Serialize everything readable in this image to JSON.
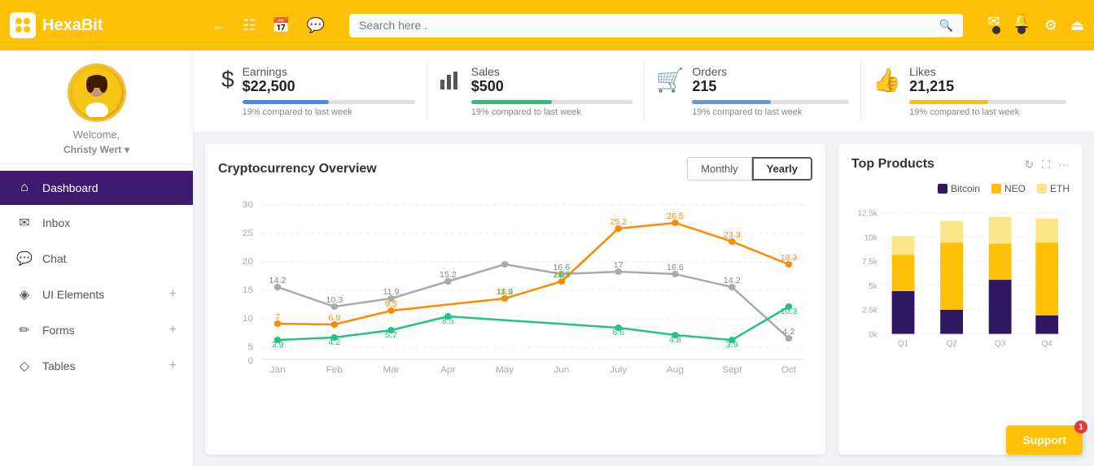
{
  "header": {
    "logo_text": "HexaBit",
    "search_placeholder": "Search here .",
    "nav_icons": [
      "back",
      "grid",
      "calendar",
      "chat"
    ]
  },
  "sidebar": {
    "welcome": "Welcome,",
    "user_name": "Christy Wert",
    "dropdown_icon": "▾",
    "nav_items": [
      {
        "id": "dashboard",
        "label": "Dashboard",
        "icon": "⌂",
        "active": true,
        "has_plus": false
      },
      {
        "id": "inbox",
        "label": "Inbox",
        "icon": "✉",
        "active": false,
        "has_plus": false
      },
      {
        "id": "chat",
        "label": "Chat",
        "icon": "💬",
        "active": false,
        "has_plus": false
      },
      {
        "id": "ui-elements",
        "label": "UI Elements",
        "icon": "◈",
        "active": false,
        "has_plus": true
      },
      {
        "id": "forms",
        "label": "Forms",
        "icon": "✏",
        "active": false,
        "has_plus": true
      },
      {
        "id": "tables",
        "label": "Tables",
        "icon": "◇",
        "active": false,
        "has_plus": true
      }
    ]
  },
  "stats": [
    {
      "id": "earnings",
      "icon": "$",
      "label": "Earnings",
      "value": "$22,500",
      "bar_color": "#3d8bff",
      "bar_pct": 50,
      "compare": "19% compared to last week"
    },
    {
      "id": "sales",
      "icon": "📊",
      "label": "Sales",
      "value": "$500",
      "bar_color": "#26c281",
      "bar_pct": 50,
      "compare": "19% compared to last week"
    },
    {
      "id": "orders",
      "icon": "🛒",
      "label": "Orders",
      "value": "215",
      "bar_color": "#5b9bd5",
      "bar_pct": 50,
      "compare": "19% compared to last week"
    },
    {
      "id": "likes",
      "icon": "👍",
      "label": "Likes",
      "value": "21,215",
      "bar_color": "#FFC107",
      "bar_pct": 50,
      "compare": "19% compared to last week"
    }
  ],
  "chart": {
    "title": "Cryptocurrency Overview",
    "toggle": {
      "monthly_label": "Monthly",
      "yearly_label": "Yearly",
      "active": "yearly"
    },
    "months": [
      "Jan",
      "Feb",
      "Mar",
      "Apr",
      "May",
      "Jun",
      "July",
      "Aug",
      "Sept",
      "Oct"
    ],
    "series": {
      "gray": [
        14.2,
        10.3,
        11.9,
        15.2,
        18.4,
        16.6,
        17.0,
        16.6,
        14.2,
        4.2
      ],
      "orange": [
        7.0,
        6.9,
        9.5,
        null,
        11.9,
        15.2,
        25.2,
        26.5,
        23.3,
        18.3
      ],
      "green": [
        3.9,
        4.2,
        5.7,
        8.5,
        null,
        null,
        6.6,
        4.8,
        3.9,
        10.3
      ]
    }
  },
  "top_products": {
    "title": "Top Products",
    "legend": [
      {
        "label": "Bitcoin",
        "color": "#2e1760"
      },
      {
        "label": "NEO",
        "color": "#FFC107"
      },
      {
        "label": "ETH",
        "color": "#fde68a"
      }
    ],
    "y_labels": [
      "12.5k",
      "10k",
      "7.5k",
      "5k",
      "2.5k",
      "0k"
    ],
    "quarters": [
      "Q1",
      "Q2",
      "Q3"
    ],
    "bars": [
      {
        "label": "Q1",
        "bitcoin": 35,
        "neo": 30,
        "eth": 15
      },
      {
        "label": "Q2",
        "bitcoin": 20,
        "neo": 55,
        "eth": 18
      },
      {
        "label": "Q3",
        "bitcoin": 45,
        "neo": 30,
        "eth": 22
      },
      {
        "label": "Q4",
        "bitcoin": 15,
        "neo": 60,
        "eth": 20
      }
    ]
  },
  "support": {
    "label": "Support",
    "badge": "1"
  }
}
